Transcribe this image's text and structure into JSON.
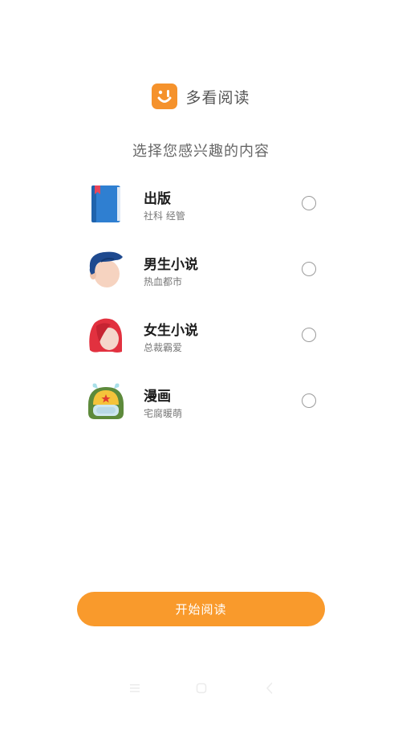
{
  "app": {
    "name": "多看阅读",
    "logo_icon": "smile-logo-icon",
    "accent_color": "#f5922c"
  },
  "headline": "选择您感兴趣的内容",
  "categories": [
    {
      "title": "出版",
      "subtitle": "社科 经管",
      "icon": "book-icon",
      "selected": false
    },
    {
      "title": "男生小说",
      "subtitle": "热血都市",
      "icon": "boy-avatar-icon",
      "selected": false
    },
    {
      "title": "女生小说",
      "subtitle": "总裁霸爱",
      "icon": "girl-avatar-icon",
      "selected": false
    },
    {
      "title": "漫画",
      "subtitle": "宅腐暖萌",
      "icon": "comic-character-icon",
      "selected": false
    }
  ],
  "cta": {
    "label": "开始阅读",
    "color": "#f99a2c"
  },
  "navbar": {
    "icons": [
      "menu-icon",
      "home-icon",
      "back-icon"
    ]
  }
}
